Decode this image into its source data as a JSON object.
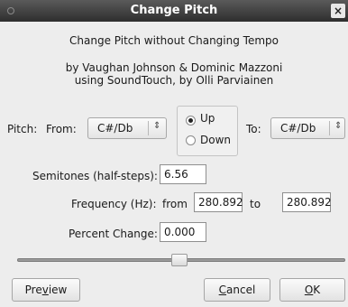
{
  "window": {
    "title": "Change Pitch"
  },
  "header": {
    "line1": "Change Pitch without Changing Tempo",
    "line2": "by Vaughan Johnson & Dominic Mazzoni",
    "line3": "using SoundTouch, by Olli Parviainen"
  },
  "pitch": {
    "label": "Pitch:",
    "from_label": "From:",
    "from_value": "C#/Db",
    "to_label": "To:",
    "to_value": "C#/Db",
    "direction": {
      "up_label": "Up",
      "down_label": "Down",
      "selected": "Up"
    }
  },
  "semitones": {
    "label": "Semitones (half-steps):",
    "value": "6.56"
  },
  "frequency": {
    "label": "Frequency (Hz):",
    "from_label": "from",
    "from_value": "280.892",
    "to_label": "to",
    "to_value": "280.892"
  },
  "percent": {
    "label": "Percent Change:",
    "value": "0.000"
  },
  "slider": {
    "level": 0.5
  },
  "buttons": {
    "preview_a": "Pre",
    "preview_u": "v",
    "preview_b": "iew",
    "cancel_u": "C",
    "cancel_b": "ancel",
    "ok_u": "O",
    "ok_b": "K"
  }
}
